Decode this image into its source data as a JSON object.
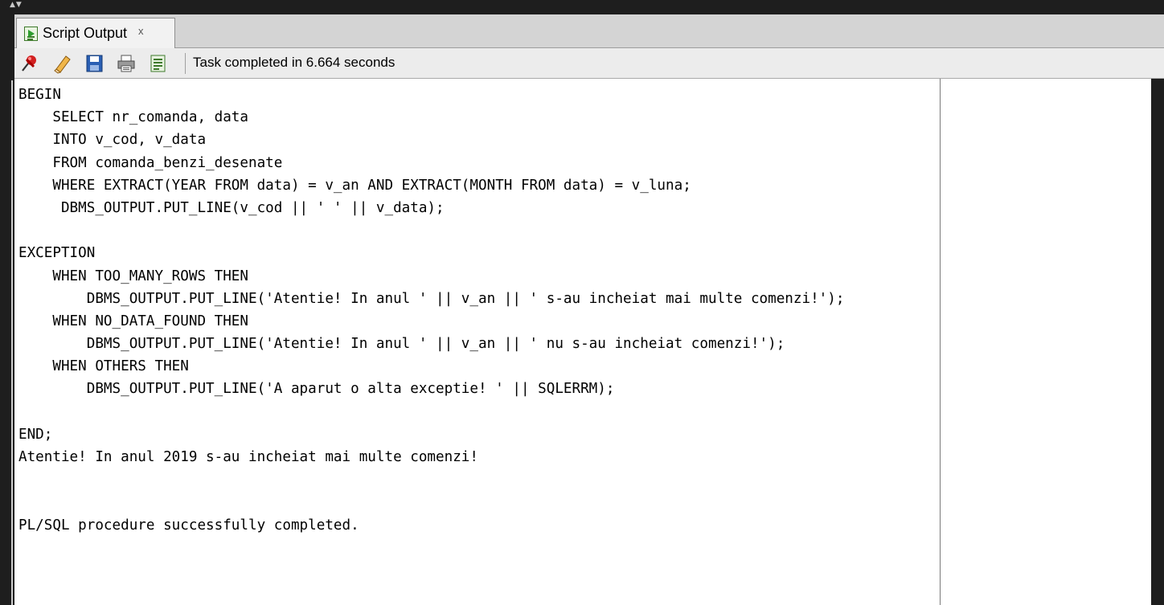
{
  "window": {
    "tab": {
      "label": "Script Output",
      "close_glyph": "x",
      "icon": "script-output-icon"
    }
  },
  "toolbar": {
    "buttons": [
      {
        "name": "pin-icon",
        "tooltip": ""
      },
      {
        "name": "clear-eraser-icon",
        "tooltip": ""
      },
      {
        "name": "save-icon",
        "tooltip": ""
      },
      {
        "name": "print-icon",
        "tooltip": ""
      },
      {
        "name": "open-file-icon",
        "tooltip": ""
      }
    ],
    "status": "Task completed in 6.664 seconds"
  },
  "output": {
    "lines": [
      "BEGIN",
      "    SELECT nr_comanda, data",
      "    INTO v_cod, v_data",
      "    FROM comanda_benzi_desenate",
      "    WHERE EXTRACT(YEAR FROM data) = v_an AND EXTRACT(MONTH FROM data) = v_luna;",
      "     DBMS_OUTPUT.PUT_LINE(v_cod || ' ' || v_data);",
      "",
      "EXCEPTION",
      "    WHEN TOO_MANY_ROWS THEN",
      "        DBMS_OUTPUT.PUT_LINE('Atentie! In anul ' || v_an || ' s-au incheiat mai multe comenzi!');",
      "    WHEN NO_DATA_FOUND THEN",
      "        DBMS_OUTPUT.PUT_LINE('Atentie! In anul ' || v_an || ' nu s-au incheiat comenzi!');",
      "    WHEN OTHERS THEN",
      "        DBMS_OUTPUT.PUT_LINE('A aparut o alta exceptie! ' || SQLERRM);",
      "",
      "END;",
      "Atentie! In anul 2019 s-au incheiat mai multe comenzi!",
      "",
      "",
      "PL/SQL procedure successfully completed."
    ]
  },
  "colors": {
    "background": "#1e1e1e",
    "editor_bg": "#ffffff",
    "toolbar_bg": "#ececec",
    "tabbar_bg": "#d4d4d4"
  }
}
